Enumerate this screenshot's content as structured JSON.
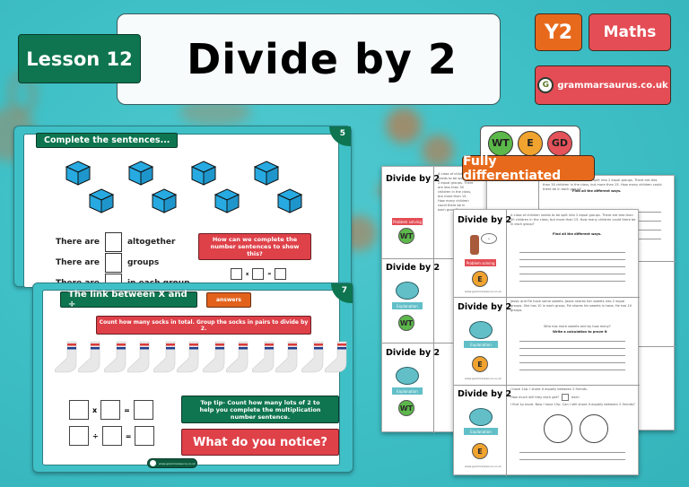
{
  "header": {
    "lesson": "Lesson 12",
    "title": "Divide by 2",
    "year": "Y2",
    "subject": "Maths",
    "brand": "grammarsaurus.co.uk",
    "brand_logo_letter": "G"
  },
  "slide5": {
    "number": "5",
    "heading": "Complete the sentences...",
    "icon": "cube-icon",
    "cube_count": 8,
    "sentences": [
      {
        "before": "There are",
        "after": "altogether"
      },
      {
        "before": "There are",
        "after": "groups"
      },
      {
        "before": "There are",
        "after": "in each group"
      }
    ],
    "prompt": "How can we complete the number sentences to show this?",
    "equation_ops": [
      "x",
      "="
    ]
  },
  "slide7": {
    "number": "7",
    "heading": "The link between X and ÷",
    "answers_label": "answers",
    "instruction": "Count how many socks in total. Group the socks in pairs to divide by 2.",
    "icon": "sock-icon",
    "sock_count": 12,
    "equations": [
      {
        "op": "x",
        "eq": "="
      },
      {
        "op": "÷",
        "eq": "="
      }
    ],
    "tip": "Top tip- Count how many lots of 2 to help you complete the multiplication number sentence.",
    "question": "What do you notice?",
    "footer": "www.grammarsaurus.co.uk"
  },
  "differentiation": {
    "levels": [
      {
        "label": "WT",
        "color": "#5cb84a"
      },
      {
        "label": "E",
        "color": "#f0a32e"
      },
      {
        "label": "GD",
        "color": "#e4525a"
      }
    ],
    "banner": "Fully differentiated"
  },
  "worksheets": {
    "title": "Divide by 2",
    "labels": {
      "problem_solving": "Problem solving",
      "explanation": "Explanation"
    },
    "find_ways": "Find all the different ways.",
    "q1_text": "A class of children needs to be split into 2 equal groups. There are less than 30 children in the class, but more than 15. How many children could there be in each group?",
    "q2_text": "Jassic and Fie have some sweets. Jassic shares her sweets into 2 equal groups. She has 10 in each group. Fie shares his sweets in twos. He has 10 groups.",
    "q2_prompt": "Who has more sweets and by how many?",
    "q2_prompt2": "Write a calculation to prove it",
    "q3_text": "I have 14p. I share it equally between 2 friends.",
    "q3_prompt": "How much will they each get?",
    "q3_unit": "each",
    "q3_text2": "I find 1p more. Now I have 15p. Can I still share it equally between 2 friends?",
    "footer": "www.grammarsaurus.co.uk"
  },
  "colors": {
    "background": "#3ec0c6",
    "green": "#0e7550",
    "red": "#df4149",
    "orange": "#e76a1c",
    "cube": "#27aae1"
  }
}
